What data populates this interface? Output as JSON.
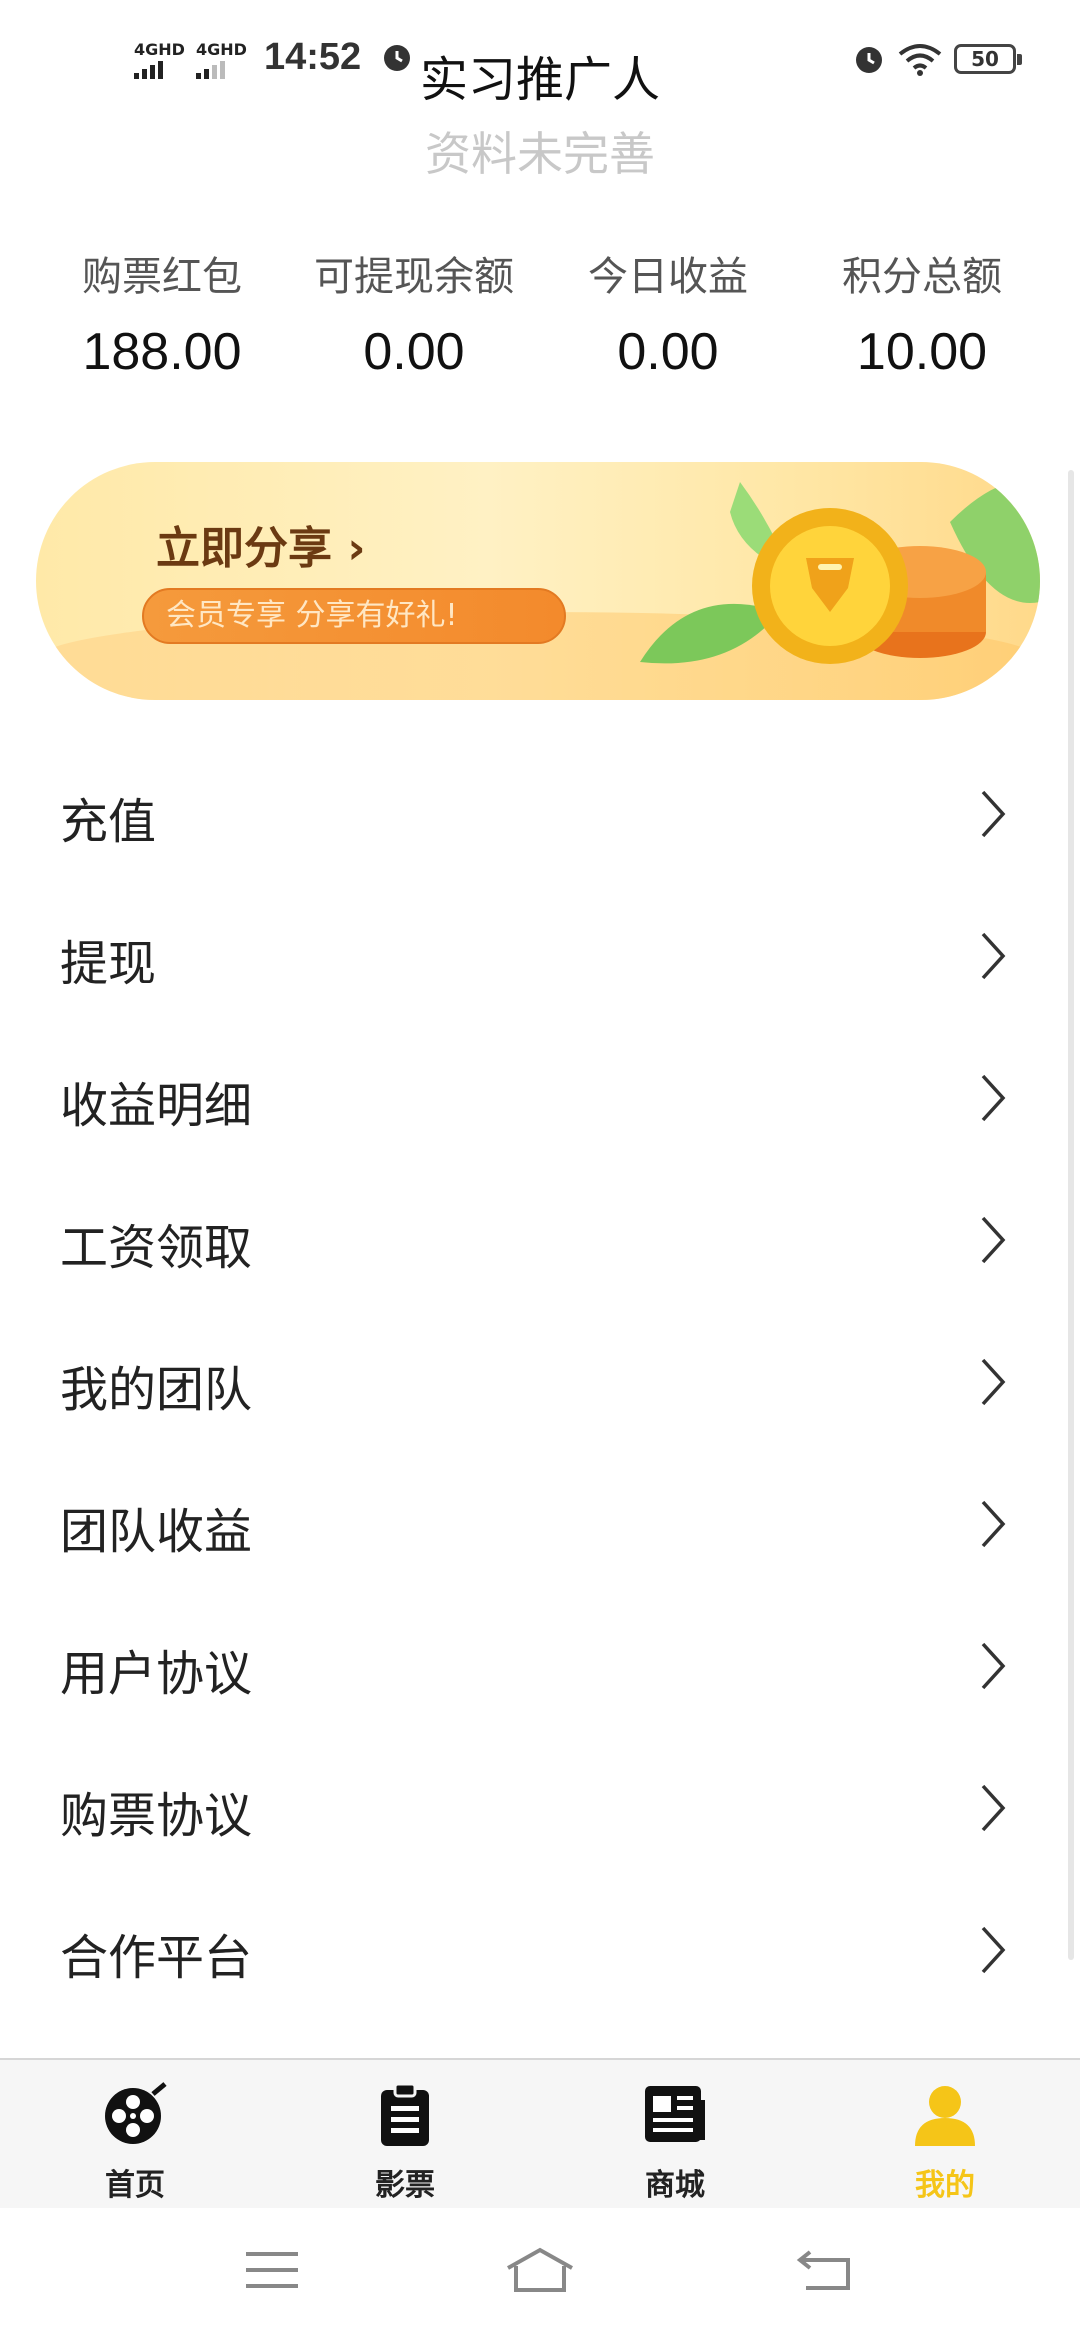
{
  "status_bar": {
    "signal_1": "4GHD",
    "signal_2": "4GHD",
    "time": "14:52",
    "battery": "50"
  },
  "header": {
    "title": "实习推广人",
    "subtitle": "资料未完善"
  },
  "stats": [
    {
      "label": "购票红包",
      "value": "188.00"
    },
    {
      "label": "可提现余额",
      "value": "0.00"
    },
    {
      "label": "今日收益",
      "value": "0.00"
    },
    {
      "label": "积分总额",
      "value": "10.00"
    }
  ],
  "banner": {
    "title": "立即分享 ›",
    "tagline": "会员专享  分享有好礼!"
  },
  "menu": [
    {
      "label": "充值"
    },
    {
      "label": "提现"
    },
    {
      "label": "收益明细"
    },
    {
      "label": "工资领取"
    },
    {
      "label": "我的团队"
    },
    {
      "label": "团队收益"
    },
    {
      "label": "用户协议"
    },
    {
      "label": "购票协议"
    },
    {
      "label": "合作平台"
    }
  ],
  "tabs": [
    {
      "label": "首页",
      "icon": "film-reel-icon"
    },
    {
      "label": "影票",
      "icon": "clipboard-icon"
    },
    {
      "label": "商城",
      "icon": "newspaper-icon"
    },
    {
      "label": "我的",
      "icon": "user-icon",
      "active": true
    }
  ],
  "colors": {
    "accent": "#f5c518",
    "subtitle": "#c8c8c8",
    "banner_pill": "#f38a2c"
  }
}
